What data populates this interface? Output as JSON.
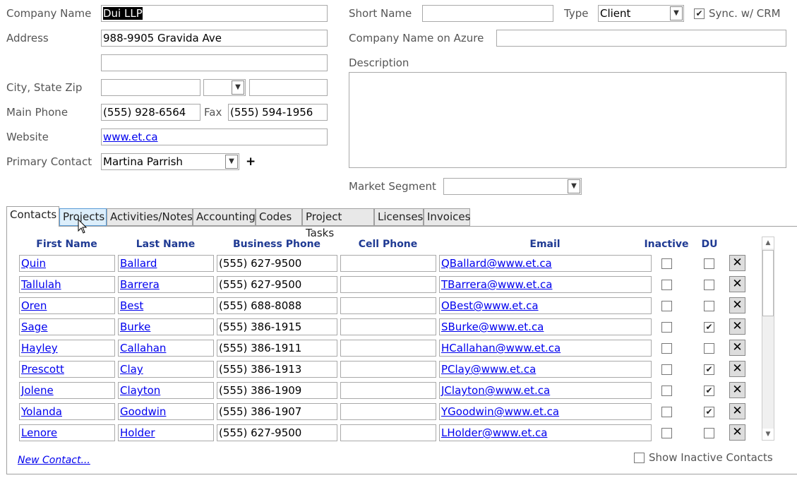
{
  "form": {
    "company_name_label": "Company Name",
    "company_name": "Dui LLP",
    "address_label": "Address",
    "address1": "988-9905 Gravida Ave",
    "address2": "",
    "city_label": "City, State Zip",
    "city": "",
    "state": "",
    "zip": "",
    "main_phone_label": "Main Phone",
    "main_phone": "(555) 928-6564",
    "fax_label": "Fax",
    "fax": "(555) 594-1956",
    "website_label": "Website",
    "website": "www.et.ca",
    "primary_contact_label": "Primary Contact",
    "primary_contact": "Martina Parrish",
    "add_symbol": "+",
    "short_name_label": "Short Name",
    "short_name": "",
    "type_label": "Type",
    "type": "Client",
    "sync_label": "Sync. w/ CRM",
    "sync_checked": true,
    "azure_label": "Company Name on Azure",
    "azure": "",
    "description_label": "Description",
    "description": "",
    "market_segment_label": "Market Segment",
    "market_segment": ""
  },
  "tabs": [
    "Contacts",
    "Projects",
    "Activities/Notes",
    "Accounting",
    "Codes",
    "Project Tasks",
    "Licenses",
    "Invoices"
  ],
  "active_tab": "Contacts",
  "contacts": {
    "headers": [
      "First Name",
      "Last Name",
      "Business Phone",
      "Cell Phone",
      "Email",
      "Inactive",
      "DU"
    ],
    "rows": [
      {
        "first": "Quin",
        "last": "Ballard",
        "phone": "(555) 627-9500",
        "cell": "",
        "email": "QBallard@www.et.ca",
        "inactive": false,
        "du": false
      },
      {
        "first": "Tallulah",
        "last": "Barrera",
        "phone": "(555) 627-9500",
        "cell": "",
        "email": "TBarrera@www.et.ca",
        "inactive": false,
        "du": false
      },
      {
        "first": "Oren",
        "last": "Best",
        "phone": "(555) 688-8088",
        "cell": "",
        "email": "OBest@www.et.ca",
        "inactive": false,
        "du": false
      },
      {
        "first": "Sage",
        "last": "Burke",
        "phone": "(555) 386-1915",
        "cell": "",
        "email": "SBurke@www.et.ca",
        "inactive": false,
        "du": true
      },
      {
        "first": "Hayley",
        "last": "Callahan",
        "phone": "(555) 386-1911",
        "cell": "",
        "email": "HCallahan@www.et.ca",
        "inactive": false,
        "du": false
      },
      {
        "first": "Prescott",
        "last": "Clay",
        "phone": "(555) 386-1913",
        "cell": "",
        "email": "PClay@www.et.ca",
        "inactive": false,
        "du": true
      },
      {
        "first": "Jolene",
        "last": "Clayton",
        "phone": "(555) 386-1909",
        "cell": "",
        "email": "JClayton@www.et.ca",
        "inactive": false,
        "du": true
      },
      {
        "first": "Yolanda",
        "last": "Goodwin",
        "phone": "(555) 386-1907",
        "cell": "",
        "email": "YGoodwin@www.et.ca",
        "inactive": false,
        "du": true
      },
      {
        "first": "Lenore",
        "last": "Holder",
        "phone": "(555) 627-9500",
        "cell": "",
        "email": "LHolder@www.et.ca",
        "inactive": false,
        "du": false
      }
    ],
    "new_contact": "New Contact...",
    "show_inactive_label": "Show Inactive Contacts",
    "show_inactive": false
  }
}
